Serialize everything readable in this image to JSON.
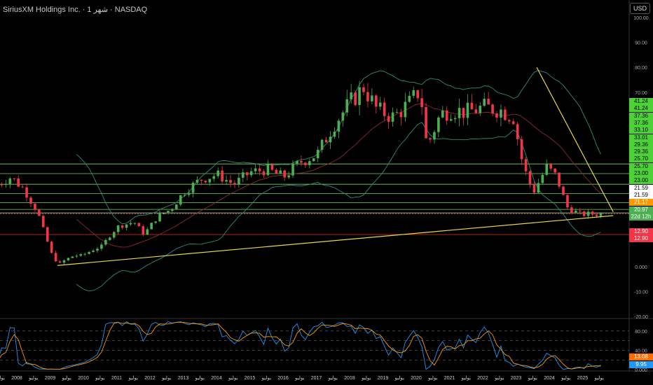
{
  "header": {
    "title": "SiriusXM Holdings Inc. · 1 شهر · NASDAQ",
    "currency": "USD"
  },
  "colors": {
    "up": "#26a69a",
    "upBody": "#4caf50",
    "down": "#f23645",
    "band": "#2a8f7a",
    "basis": "#8b2a2a",
    "level": "#7bd35a",
    "trend": "#e8d84a",
    "resist": "#c62828",
    "rsi": "#2196f3",
    "rsiMa": "#ff9800"
  },
  "chart_data": {
    "type": "candlestick",
    "price_axis": {
      "ticks": [
        100,
        90,
        80,
        70,
        0,
        -10,
        -20
      ],
      "tick_labels": [
        "100.00",
        "90.00",
        "80.00",
        "70.00",
        "0.000",
        "-10.00",
        "-20.00"
      ],
      "range": [
        -20,
        100
      ]
    },
    "time_axis": {
      "labels": [
        "يوليو",
        "2008",
        "يوليو",
        "2009",
        "يوليو",
        "2010",
        "يوليو",
        "2011",
        "يوليو",
        "2012",
        "يوليو",
        "2013",
        "يوليو",
        "2014",
        "يوليو",
        "2015",
        "يوليو",
        "2016",
        "يوليو",
        "2017",
        "يوليو",
        "2018",
        "يوليو",
        "2019",
        "يوليو",
        "2020",
        "يوليو",
        "2021",
        "يوليو",
        "2022",
        "يوليو",
        "2023",
        "يوليو",
        "2024",
        "يوليو",
        "2025",
        "يوليو"
      ],
      "range": [
        2007.5,
        2025.9
      ]
    },
    "close_keypoints": [
      [
        2007.4,
        33
      ],
      [
        2007.8,
        36
      ],
      [
        2008.2,
        31
      ],
      [
        2008.6,
        22
      ],
      [
        2009.0,
        6
      ],
      [
        2009.2,
        1
      ],
      [
        2009.6,
        4
      ],
      [
        2010.0,
        5
      ],
      [
        2010.5,
        8
      ],
      [
        2011.0,
        16
      ],
      [
        2011.5,
        18
      ],
      [
        2011.8,
        13
      ],
      [
        2012.2,
        20
      ],
      [
        2012.6,
        23
      ],
      [
        2013.0,
        30
      ],
      [
        2013.5,
        35
      ],
      [
        2014.0,
        37
      ],
      [
        2014.5,
        33
      ],
      [
        2015.0,
        38
      ],
      [
        2015.5,
        39
      ],
      [
        2016.0,
        36
      ],
      [
        2016.5,
        42
      ],
      [
        2017.0,
        45
      ],
      [
        2017.5,
        57
      ],
      [
        2018.0,
        66
      ],
      [
        2018.4,
        72
      ],
      [
        2018.8,
        63
      ],
      [
        2019.3,
        60
      ],
      [
        2019.8,
        66
      ],
      [
        2020.1,
        71
      ],
      [
        2020.3,
        48
      ],
      [
        2020.7,
        61
      ],
      [
        2021.0,
        63
      ],
      [
        2021.5,
        62
      ],
      [
        2022.0,
        64
      ],
      [
        2022.5,
        63
      ],
      [
        2022.9,
        60
      ],
      [
        2023.2,
        40
      ],
      [
        2023.5,
        30
      ],
      [
        2023.9,
        40
      ],
      [
        2024.2,
        36
      ],
      [
        2024.5,
        24
      ],
      [
        2024.9,
        21
      ],
      [
        2025.5,
        21.2
      ]
    ],
    "horizontal_levels": [
      {
        "value": 41.24,
        "color": "green"
      },
      {
        "value": 37.36,
        "color": "green"
      },
      {
        "value": 33.1,
        "color": "green"
      },
      {
        "value": 29.36,
        "color": "green"
      },
      {
        "value": 25.7,
        "color": "green"
      },
      {
        "value": 23.0,
        "color": "green"
      },
      {
        "value": 21.59,
        "color": "white"
      },
      {
        "value": 12.9,
        "color": "red"
      }
    ],
    "trendlines": [
      {
        "from": [
          2009.2,
          0.5
        ],
        "to": [
          2025.9,
          20.5
        ]
      },
      {
        "from": [
          2023.6,
          80
        ],
        "to": [
          2025.9,
          22
        ]
      }
    ],
    "price_labels": [
      {
        "text": "41.24",
        "type": "green"
      },
      {
        "text": "41.24",
        "type": "green"
      },
      {
        "text": "37.36",
        "type": "green"
      },
      {
        "text": "37.36",
        "type": "green"
      },
      {
        "text": "33.10",
        "type": "green"
      },
      {
        "text": "33.01",
        "type": "green"
      },
      {
        "text": "29.36",
        "type": "green"
      },
      {
        "text": "29.36",
        "type": "green"
      },
      {
        "text": "25.70",
        "type": "green"
      },
      {
        "text": "25.70",
        "type": "green"
      },
      {
        "text": "23.00",
        "type": "green"
      },
      {
        "text": "23.00",
        "type": "green"
      },
      {
        "text": "21.59",
        "type": "white"
      },
      {
        "text": "21.59",
        "type": "white"
      },
      {
        "text": "21.17",
        "type": "orange"
      },
      {
        "text": "20.97",
        "type": "dkgreen"
      },
      {
        "text": "22d 12h",
        "type": "dkgreen"
      },
      {
        "text": "12.90",
        "type": "red"
      },
      {
        "text": "12.90",
        "type": "red"
      }
    ],
    "current_price": 21.17,
    "oscillator": {
      "ticks": [
        "80.00",
        "40.00",
        "0.000"
      ],
      "labels": [
        "13.08",
        "9.95"
      ]
    }
  }
}
